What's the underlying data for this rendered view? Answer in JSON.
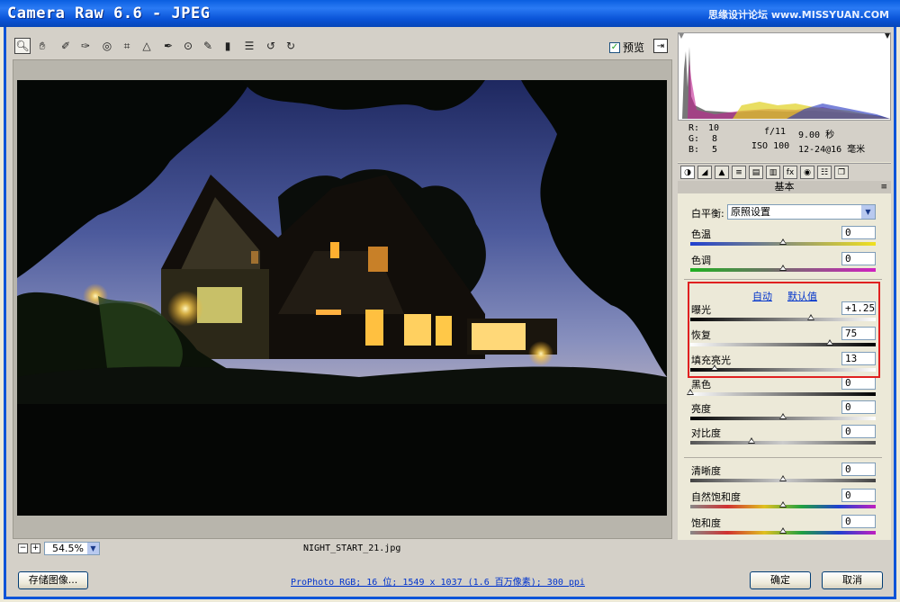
{
  "window": {
    "title": "Camera Raw 6.6 -  JPEG",
    "watermark": "思缘设计论坛 www.MISSYUAN.COM"
  },
  "toolbar": {
    "tools": [
      "zoom-tool-icon",
      "hand-tool-icon",
      "white-balance-tool-icon",
      "color-sampler-tool-icon",
      "target-adjustment-tool-icon",
      "crop-tool-icon",
      "straighten-tool-icon",
      "spot-removal-tool-icon",
      "red-eye-tool-icon",
      "adjustment-brush-icon",
      "graduated-filter-icon",
      "preferences-icon",
      "rotate-ccw-icon",
      "rotate-cw-icon"
    ],
    "preview_label": "预览",
    "preview_checked": true
  },
  "status": {
    "zoom": "54.5%",
    "filename": "NIGHT_START_21.jpg"
  },
  "readout": {
    "r_label": "R:",
    "r": "10",
    "g_label": "G:",
    "g": "8",
    "b_label": "B:",
    "b": "5",
    "aperture": "f/11",
    "shutter": "9.00 秒",
    "iso": "ISO 100",
    "focal": "12-24@16 毫米"
  },
  "panel": {
    "title": "基本",
    "white_balance_label": "白平衡:",
    "white_balance_value": "原照设置",
    "auto_link": "自动",
    "default_link": "默认值",
    "sliders": {
      "temperature": {
        "label": "色温",
        "value": "0",
        "pos": 0.5
      },
      "tint": {
        "label": "色调",
        "value": "0",
        "pos": 0.5
      },
      "exposure": {
        "label": "曝光",
        "value": "+1.25",
        "pos": 0.65
      },
      "recovery": {
        "label": "恢复",
        "value": "75",
        "pos": 0.75
      },
      "fill_light": {
        "label": "填充亮光",
        "value": "13",
        "pos": 0.13
      },
      "blacks": {
        "label": "黑色",
        "value": "0",
        "pos": 0.0
      },
      "brightness": {
        "label": "亮度",
        "value": "0",
        "pos": 0.5
      },
      "contrast": {
        "label": "对比度",
        "value": "0",
        "pos": 0.33
      },
      "clarity": {
        "label": "清晰度",
        "value": "0",
        "pos": 0.5
      },
      "vibrance": {
        "label": "自然饱和度",
        "value": "0",
        "pos": 0.5
      },
      "saturation": {
        "label": "饱和度",
        "value": "0",
        "pos": 0.5
      }
    }
  },
  "footer": {
    "save_button": "存储图像...",
    "info_link": "ProPhoto RGB; 16 位; 1549 x 1037 (1.6 百万像素); 300 ppi",
    "ok_button": "确定",
    "cancel_button": "取消"
  },
  "colors": {
    "title_bar": "#0a54d8",
    "highlight_box": "#e02020",
    "link": "#0033cc"
  }
}
